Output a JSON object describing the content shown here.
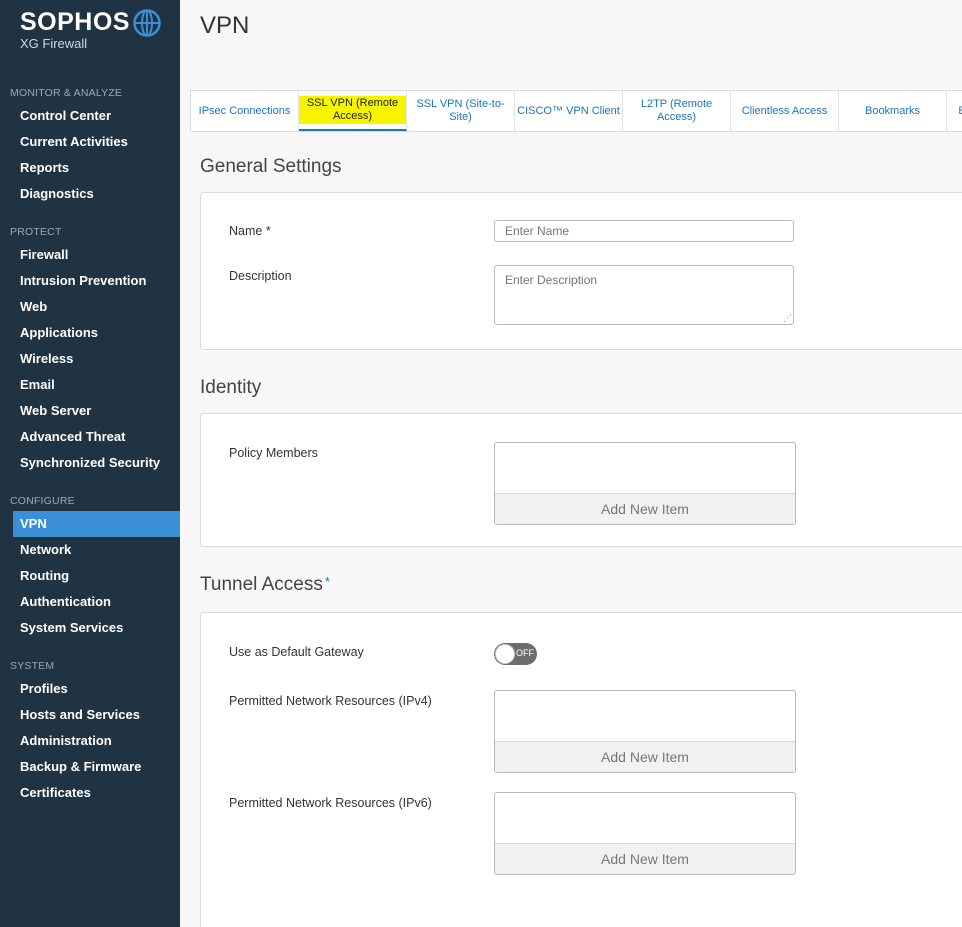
{
  "brand": {
    "name": "SOPHOS",
    "product": "XG Firewall",
    "logo_icon": "globe-icon"
  },
  "sidebar": {
    "sections": [
      {
        "title": "MONITOR & ANALYZE",
        "items": [
          "Control Center",
          "Current Activities",
          "Reports",
          "Diagnostics"
        ]
      },
      {
        "title": "PROTECT",
        "items": [
          "Firewall",
          "Intrusion Prevention",
          "Web",
          "Applications",
          "Wireless",
          "Email",
          "Web Server",
          "Advanced Threat",
          "Synchronized Security"
        ]
      },
      {
        "title": "CONFIGURE",
        "items": [
          "VPN",
          "Network",
          "Routing",
          "Authentication",
          "System Services"
        ]
      },
      {
        "title": "SYSTEM",
        "items": [
          "Profiles",
          "Hosts and Services",
          "Administration",
          "Backup & Firmware",
          "Certificates"
        ]
      }
    ],
    "active_item": "VPN"
  },
  "page": {
    "title": "VPN"
  },
  "tabs": [
    {
      "label": "IPsec Connections"
    },
    {
      "label": "SSL VPN (Remote Access)",
      "active": true
    },
    {
      "label": "SSL VPN (Site-to-Site)"
    },
    {
      "label": "CISCO™ VPN Client"
    },
    {
      "label": "L2TP (Remote Access)"
    },
    {
      "label": "Clientless Access"
    },
    {
      "label": "Bookmarks"
    },
    {
      "label": "B"
    }
  ],
  "general": {
    "heading": "General Settings",
    "name_label": "Name *",
    "name_placeholder": "Enter Name",
    "description_label": "Description",
    "description_placeholder": "Enter Description"
  },
  "identity": {
    "heading": "Identity",
    "policy_members_label": "Policy Members",
    "add_new_item": "Add New Item"
  },
  "tunnel": {
    "heading": "Tunnel Access",
    "required_mark": "*",
    "default_gateway_label": "Use as Default Gateway",
    "default_gateway_state": "OFF",
    "ipv4_label": "Permitted Network Resources (IPv4)",
    "ipv6_label": "Permitted Network Resources (IPv6)",
    "add_new_item": "Add New Item"
  },
  "colors": {
    "sidebar_bg": "#1f3343",
    "active_nav": "#3a8fd6",
    "link_blue": "#1a74c3",
    "tab_highlight": "#f7f400",
    "toggle_off": "#6d6d6d"
  }
}
